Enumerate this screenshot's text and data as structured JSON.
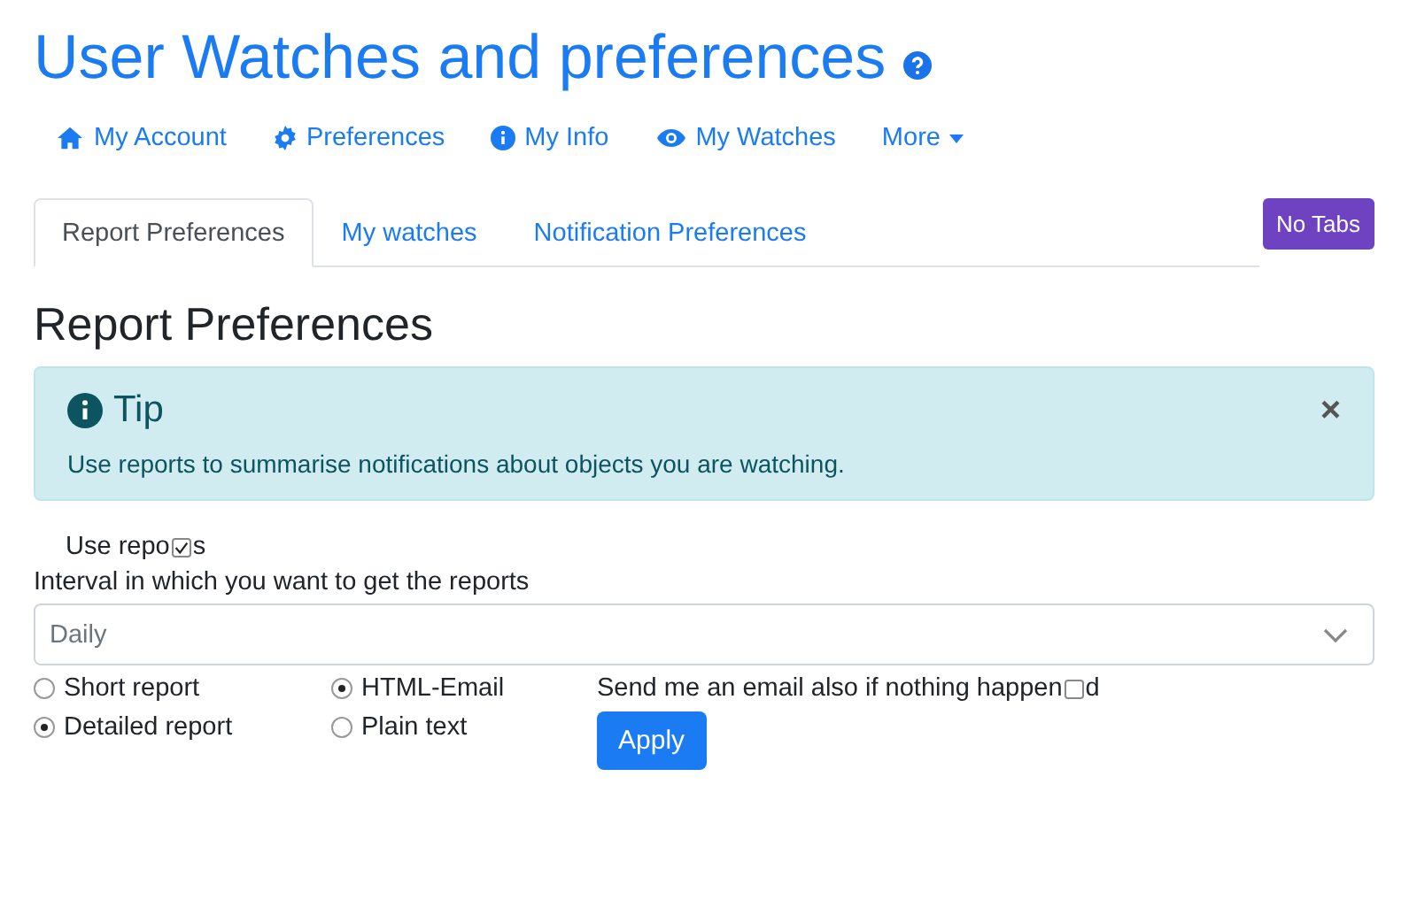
{
  "page": {
    "title": "User Watches and preferences"
  },
  "nav": [
    {
      "label": "My Account",
      "kind": "home"
    },
    {
      "label": "Preferences",
      "kind": "gear"
    },
    {
      "label": "My Info",
      "kind": "info"
    },
    {
      "label": "My Watches",
      "kind": "eye"
    },
    {
      "label": "More",
      "kind": "dropdown"
    }
  ],
  "tabs": [
    {
      "label": "Report Preferences",
      "selected": true
    },
    {
      "label": "My watches",
      "selected": false
    },
    {
      "label": "Notification Preferences",
      "selected": false
    }
  ],
  "no_tabs_button": "No Tabs",
  "heading": "Report Preferences",
  "tip": {
    "title": "Tip",
    "text": "Use reports to summarise notifications about objects you are watching.",
    "close": "×"
  },
  "use_reports": {
    "before": "Use repo",
    "after": "s",
    "checked": true
  },
  "interval": {
    "label": "Interval in which you want to get the reports",
    "value": "Daily"
  },
  "report_type": [
    {
      "label": "Short report",
      "selected": false
    },
    {
      "label": "Detailed report",
      "selected": true
    }
  ],
  "format": [
    {
      "label": "HTML-Email",
      "selected": true
    },
    {
      "label": "Plain text",
      "selected": false
    }
  ],
  "send_empty": {
    "before": "Send me an email also if nothing happen",
    "after": "d",
    "checked": false
  },
  "apply_button": "Apply"
}
